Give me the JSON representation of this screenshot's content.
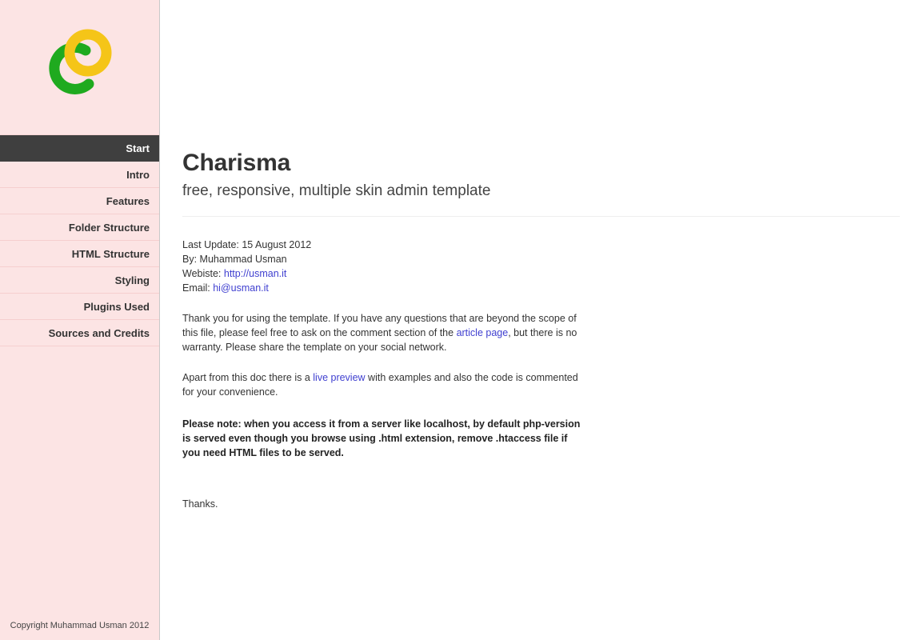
{
  "sidebar": {
    "logo": {
      "icon": "charisma-logo-icon",
      "ring_color": "#f5c518",
      "arc_color": "#1faa1f"
    },
    "items": [
      {
        "label": "Start",
        "active": true
      },
      {
        "label": "Intro",
        "active": false
      },
      {
        "label": "Features",
        "active": false
      },
      {
        "label": "Folder Structure",
        "active": false
      },
      {
        "label": "HTML Structure",
        "active": false
      },
      {
        "label": "Styling",
        "active": false
      },
      {
        "label": "Plugins Used",
        "active": false
      },
      {
        "label": "Sources and Credits",
        "active": false
      }
    ],
    "footer": "Copyright Muhammad Usman 2012",
    "background_color": "#fce4e4",
    "active_background_color": "#3f3f3f"
  },
  "main": {
    "title": "Charisma",
    "subtitle": "free, responsive, multiple skin admin template",
    "meta": {
      "last_update_label": "Last Update: ",
      "last_update_value": "15 August 2012",
      "by_label": "By: ",
      "by_value": "Muhammad Usman",
      "website_label": "Webiste: ",
      "website_value": "http://usman.it",
      "email_label": "Email: ",
      "email_value": "hi@usman.it"
    },
    "paragraph1": {
      "part1": "Thank you for using the template. If you have any questions that are beyond the scope of this file, please feel free to ask on the comment section of the ",
      "link": "article page",
      "part2": ", but there is no warranty. Please share the template on your social network."
    },
    "paragraph2": {
      "part1": "Apart from this doc there is a ",
      "link": "live preview",
      "part2": " with examples and also the code is commented for your convenience."
    },
    "note": "Please note: when you access it from a server like localhost, by default php-version is served even though you browse using .html extension, remove .htaccess file if you need HTML files to be served.",
    "thanks": "Thanks.",
    "link_color": "#4040d0"
  }
}
